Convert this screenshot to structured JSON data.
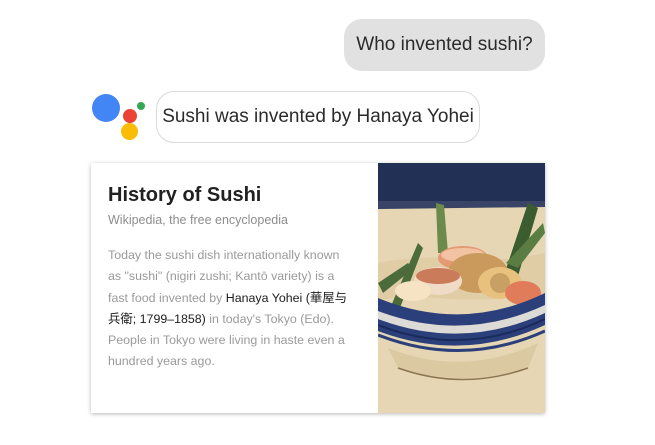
{
  "user_message": "Who invented sushi?",
  "assistant": {
    "logo": {
      "icon": "google-assistant-icon",
      "colors": {
        "blue": "#4285f4",
        "red": "#ea4335",
        "yellow": "#fbbc05",
        "green": "#34a853"
      }
    },
    "response": "Sushi was invented by Hanaya Yohei"
  },
  "card": {
    "title": "History of Sushi",
    "source": "Wikipedia, the free encyclopedia",
    "body_before": "Today the sushi dish internationally known as \"sushi\" (nigiri zushi; Kantō variety) is a fast food invented by ",
    "body_highlight": "Hanaya Yohei (華屋与兵衛; 1799–1858)",
    "body_after": " in today's Tokyo (Edo). People in Tokyo were living in haste even a hundred years ago.",
    "image": "ukiyo-e painting of sushi in a decorated bowl"
  }
}
